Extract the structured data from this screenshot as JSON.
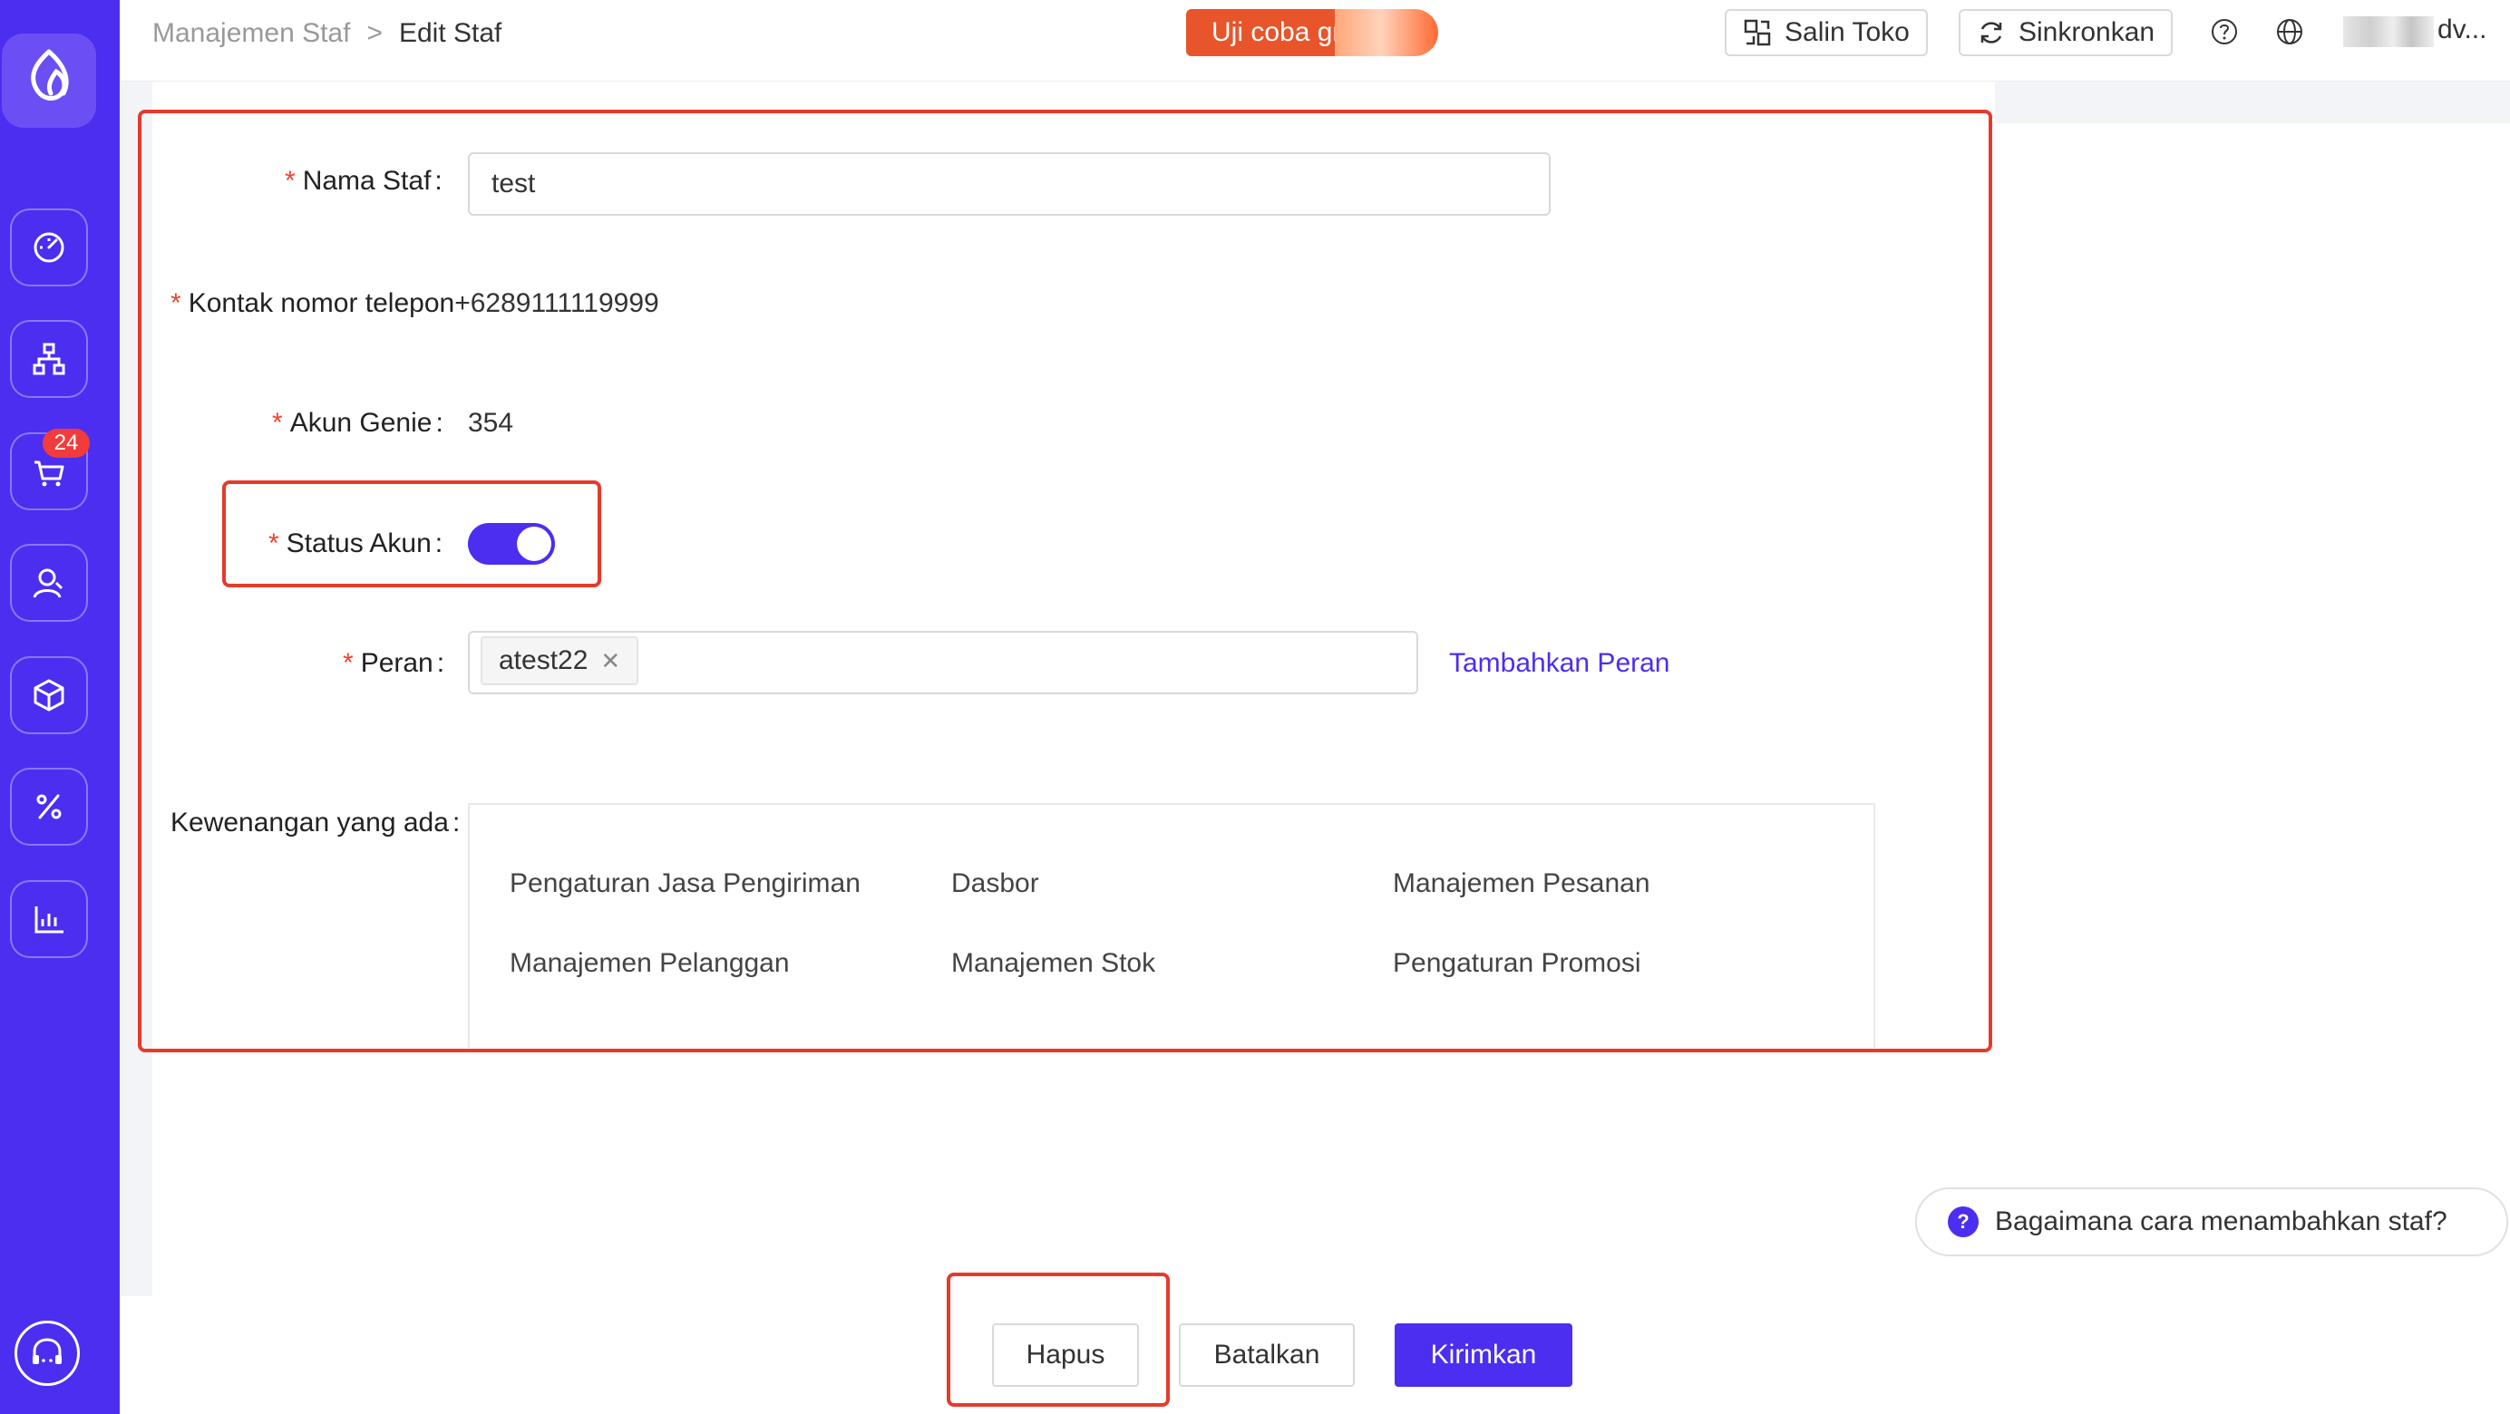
{
  "breadcrumb": {
    "parent": "Manajemen Staf",
    "separator": ">",
    "current": "Edit Staf"
  },
  "header": {
    "trial_label": "Uji coba gratis",
    "copy_store_label": "Salin Toko",
    "sync_label": "Sinkronkan",
    "user_name": "dv..."
  },
  "sidebar": {
    "cart_badge": "24",
    "items": [
      {
        "icon": "dashboard-icon"
      },
      {
        "icon": "org-chart-icon"
      },
      {
        "icon": "cart-icon"
      },
      {
        "icon": "customers-icon"
      },
      {
        "icon": "box-icon"
      },
      {
        "icon": "percent-icon"
      },
      {
        "icon": "bar-chart-icon"
      }
    ]
  },
  "form": {
    "name_label": "Nama Staf",
    "name_value": "test",
    "phone_label": "Kontak nomor telepon",
    "phone_value": "+6289111119999",
    "account_label": "Akun Genie",
    "account_value": "354",
    "status_label": "Status Akun",
    "status_on": true,
    "role_label": "Peran",
    "role_tag": "atest22",
    "add_role_link": "Tambahkan Peran",
    "permissions_label": "Kewenangan yang ada",
    "colon": ":",
    "required_mark": "*",
    "permissions": [
      "Pengaturan Jasa Pengiriman",
      "Dasbor",
      "Manajemen Pesanan",
      "Manajemen Pelanggan",
      "Manajemen Stok",
      "Pengaturan Promosi"
    ]
  },
  "help": {
    "text": "Bagaimana cara menambahkan staf?"
  },
  "actions": {
    "delete": "Hapus",
    "cancel": "Batalkan",
    "submit": "Kirimkan"
  },
  "colors": {
    "primary": "#4b2ef0",
    "trial": "#e8552a",
    "highlight": "#e53b2c",
    "badge": "#f23b3b"
  }
}
